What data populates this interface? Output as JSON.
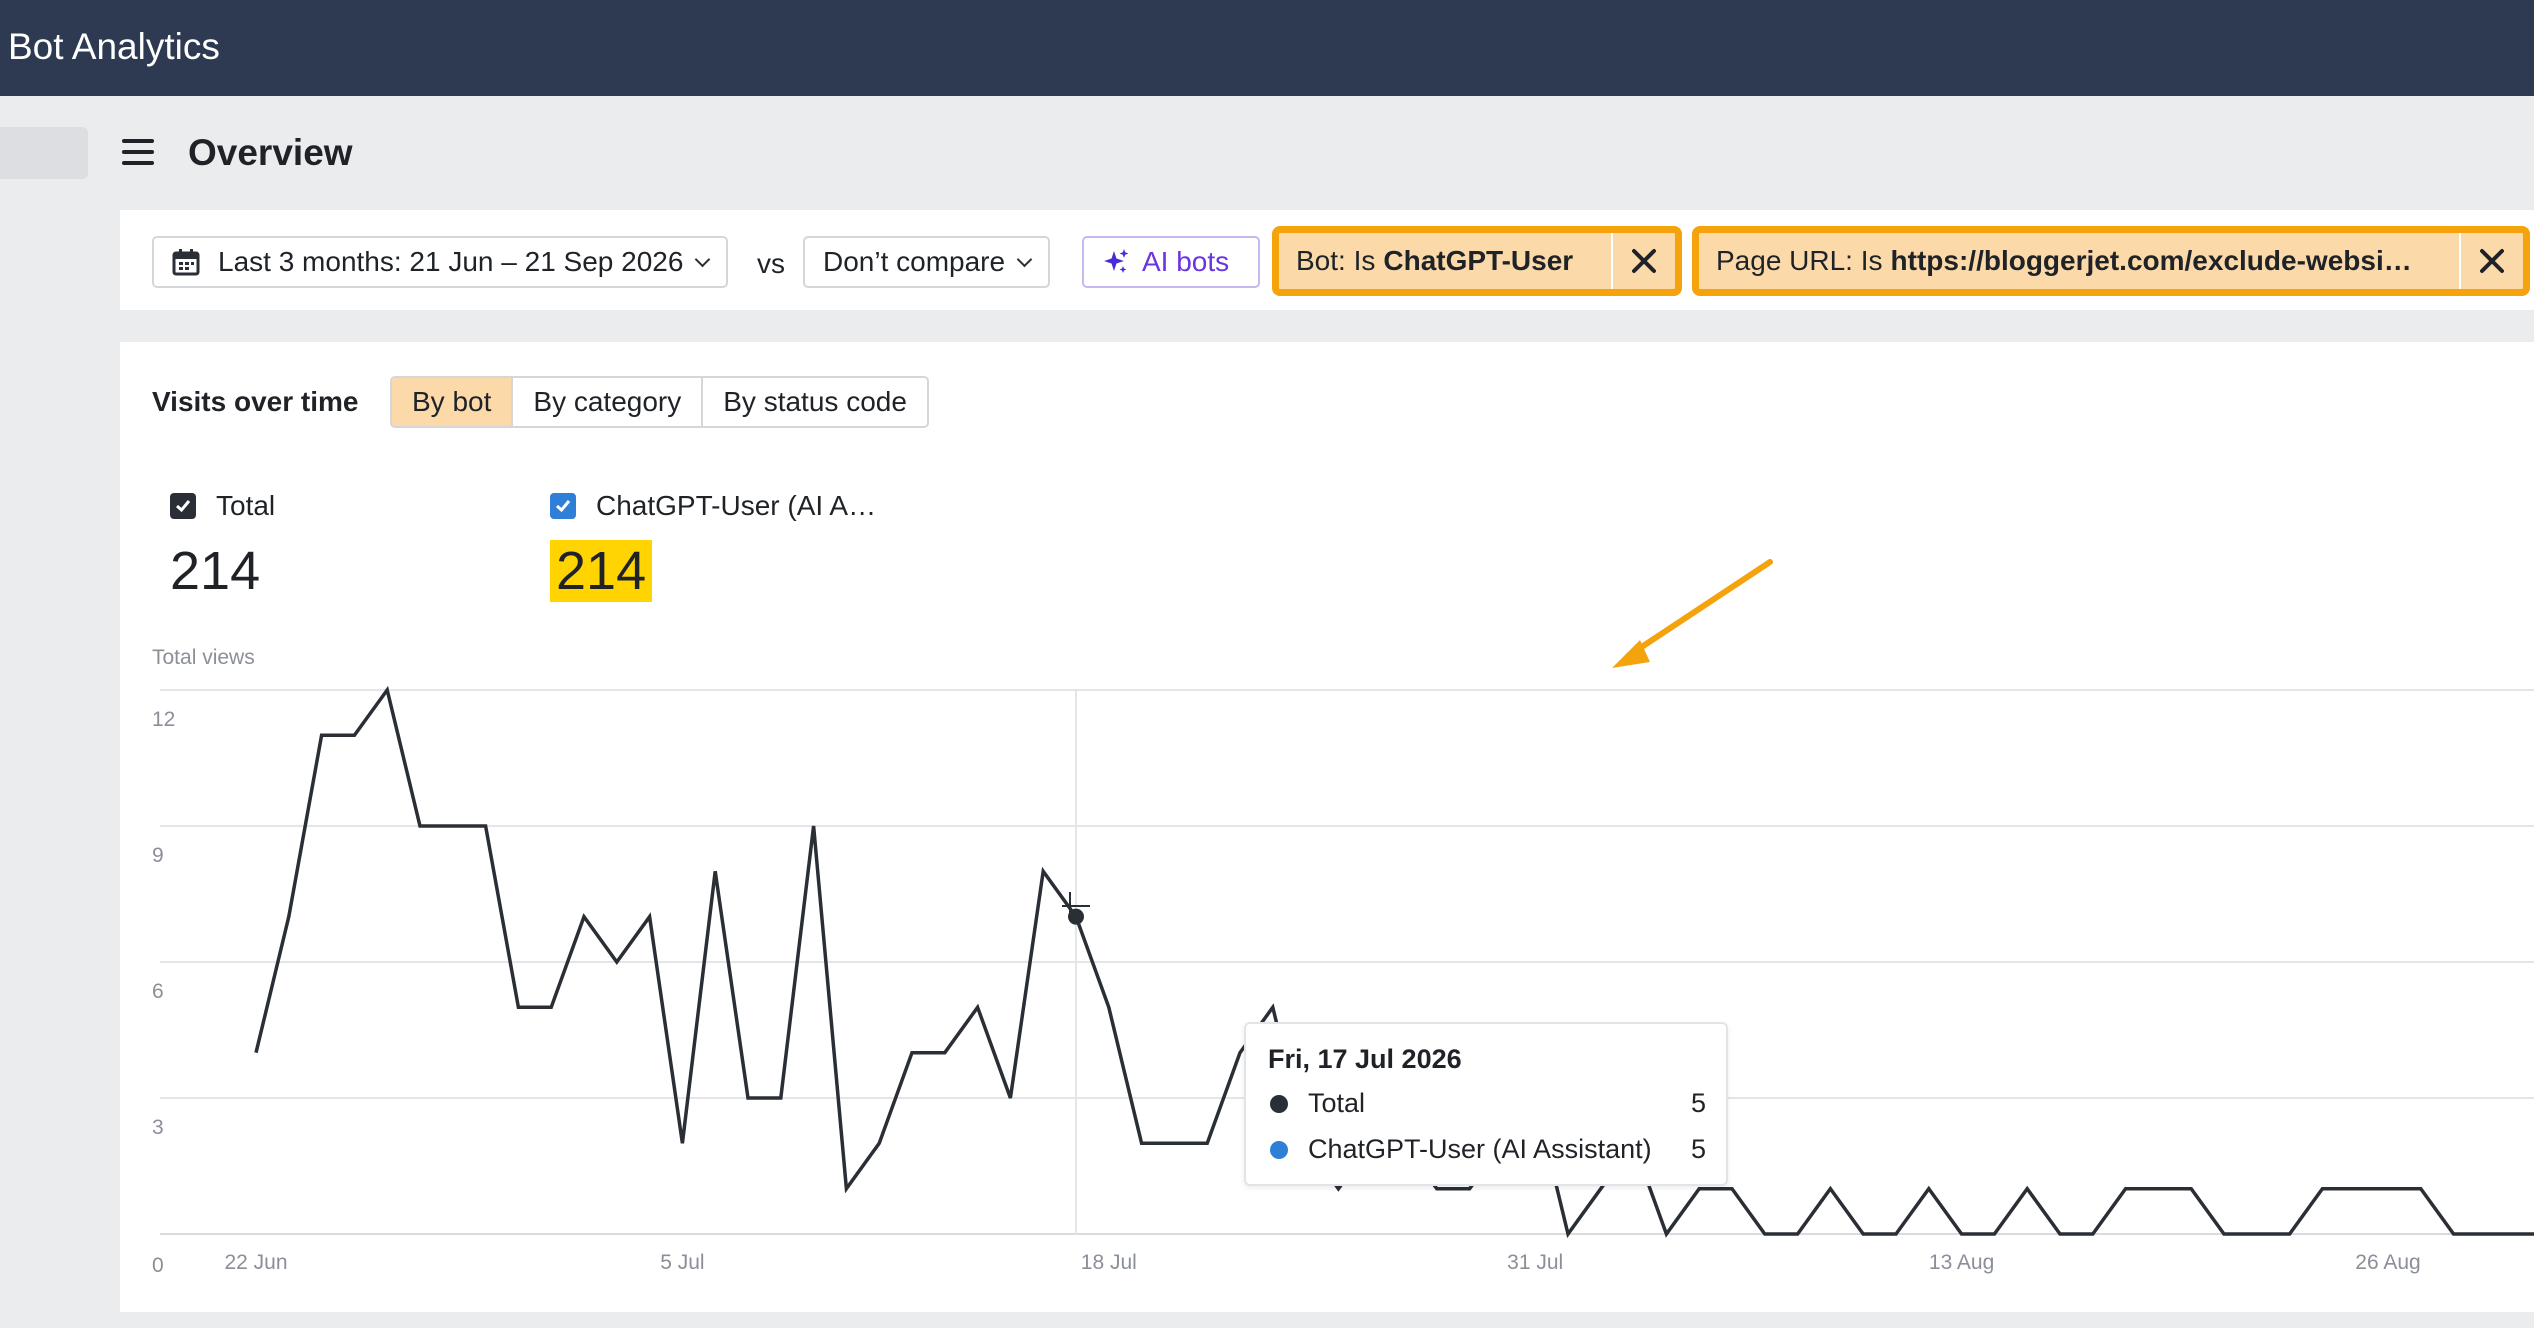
{
  "app": {
    "title": "Bot Analytics"
  },
  "header": {
    "title": "Overview"
  },
  "filters": {
    "date_range": "Last 3 months: 21 Jun – 21 Sep 2026",
    "vs_label": "vs",
    "compare": "Don’t compare",
    "ai_bots": "AI bots",
    "chip1_prefix": "Bot: Is",
    "chip1_value": "ChatGPT-User",
    "chip2_prefix": "Page URL: Is",
    "chip2_value": "https://bloggerjet.com/exclude-websi…"
  },
  "visits": {
    "title": "Visits over time",
    "tabs": [
      "By bot",
      "By category",
      "By status code"
    ],
    "active_tab": 0
  },
  "metrics": [
    {
      "label": "Total",
      "value": "214",
      "checkbox_color": "#2a2e35"
    },
    {
      "label": "ChatGPT-User (AI A…",
      "value": "214",
      "checkbox_color": "#2f7fd6"
    }
  ],
  "tooltip": {
    "date": "Fri, 17 Jul 2026",
    "rows": [
      {
        "label": "Total",
        "value": "5",
        "color": "#2a2e35"
      },
      {
        "label": "ChatGPT-User (AI Assistant)",
        "value": "5",
        "color": "#2f7fd6"
      }
    ]
  },
  "colors": {
    "accent_orange": "#f5a30d",
    "chip_bg": "#fcd9a8",
    "highlight": "#ffd400",
    "line": "#2a2e35",
    "navy": "#2d3a52"
  },
  "chart_data": {
    "type": "line",
    "ylabel": "Total views",
    "ylim": [
      0,
      12
    ],
    "y_ticks": [
      0,
      3,
      6,
      9,
      12
    ],
    "x_tick_labels": [
      "22 Jun",
      "5 Jul",
      "18 Jul",
      "31 Jul",
      "13 Aug",
      "26 Aug"
    ],
    "x_start_date": "2026-06-22",
    "grid": true,
    "series": [
      {
        "name": "Total",
        "values": [
          4,
          7,
          11,
          11,
          12,
          9,
          9,
          9,
          5,
          5,
          7,
          6,
          7,
          2,
          8,
          3,
          3,
          9,
          1,
          2,
          4,
          4,
          5,
          3,
          8,
          7,
          5,
          2,
          2,
          2,
          4,
          5,
          2,
          1,
          2,
          2,
          1,
          1,
          2,
          3,
          0,
          1,
          2,
          0,
          1,
          1,
          0,
          0,
          1,
          0,
          0,
          1,
          0,
          0,
          1,
          0,
          0,
          1,
          1,
          1,
          0,
          0,
          0,
          1,
          1,
          1,
          1,
          0,
          0,
          0,
          0
        ]
      }
    ],
    "hover_date": "2026-07-17",
    "hover_value": 5
  }
}
